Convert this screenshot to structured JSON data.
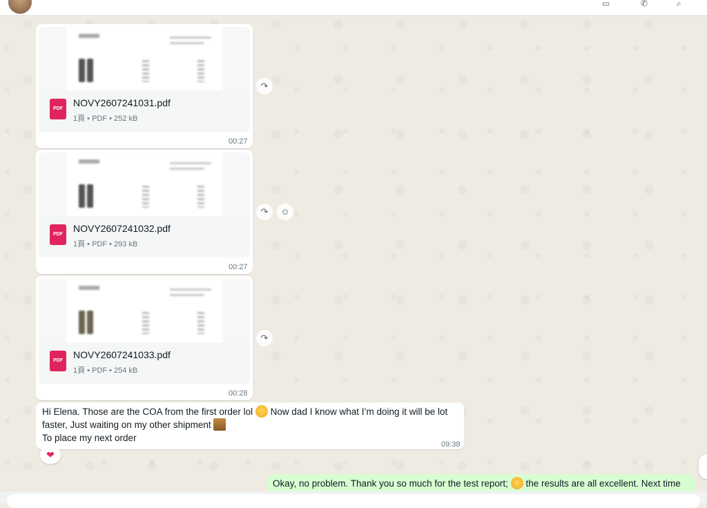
{
  "topbar": {
    "avatar": "contact-avatar",
    "icons": [
      "video-call-icon",
      "voice-call-icon",
      "search-icon"
    ]
  },
  "files": [
    {
      "name": "NOVY2607241031.pdf",
      "meta": "1頁 • PDF • 252 kB",
      "time": "00:27",
      "icon": "pdf-icon"
    },
    {
      "name": "NOVY2607241032.pdf",
      "meta": "1頁 • PDF • 293 kB",
      "time": "00:27",
      "icon": "pdf-icon"
    },
    {
      "name": "NOVY2607241033.pdf",
      "meta": "1頁 • PDF • 254 kB",
      "time": "00:28",
      "icon": "pdf-icon"
    }
  ],
  "pdf_icon_label": "PDF",
  "incoming_text": {
    "line1_a": "Hi Elena. Those are the COA from the first order lol",
    "line1_b": "Now dad I know what I’m doing it will be lot",
    "line2": "faster, Just waiting on my other shipment",
    "line3": "To place my next order",
    "time": "09:38",
    "reaction": "❤"
  },
  "outgoing_text": {
    "part1": "Okay, no problem. Thank you so much for the test report;",
    "part2": "the results are all excellent. Next time"
  },
  "icons": {
    "forward": "↷",
    "emoji_react": "☺"
  },
  "colors": {
    "chat_bg": "#efeae2",
    "outgoing_bubble": "#d9fdd3",
    "pdf_red": "#e0245e"
  }
}
